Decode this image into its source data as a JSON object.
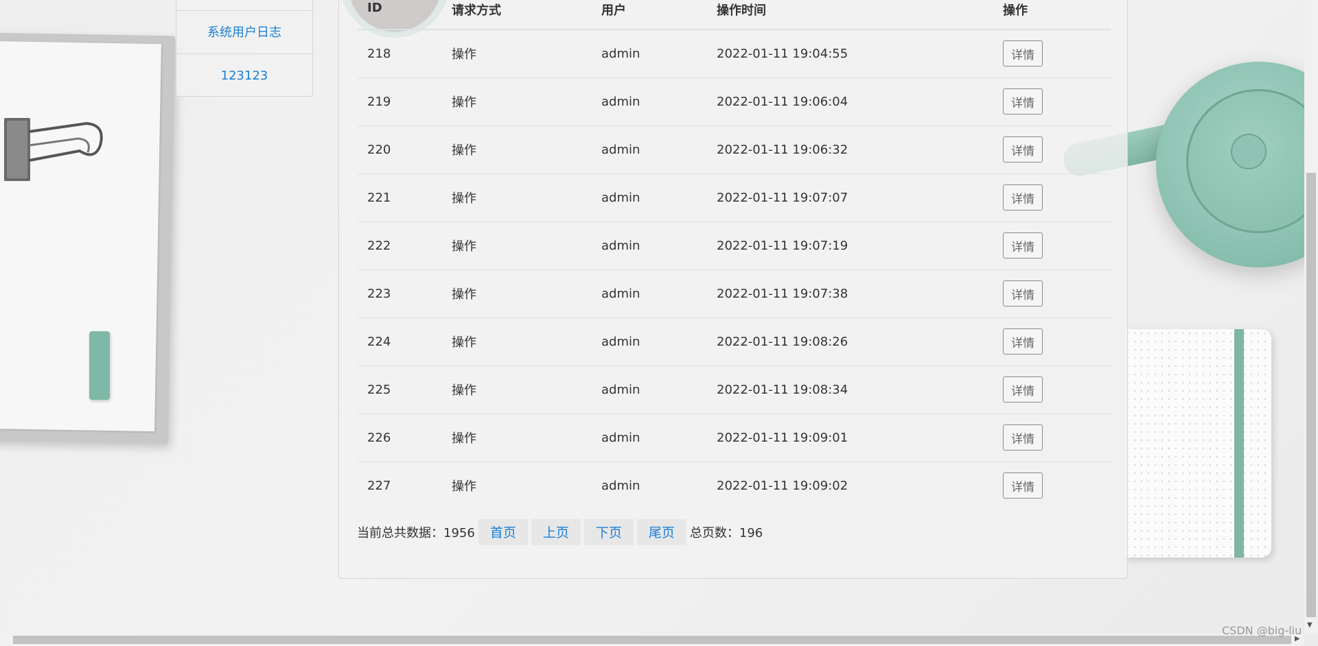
{
  "sidebar": {
    "items": [
      {
        "label": ""
      },
      {
        "label": "系统用户日志"
      },
      {
        "label": "123123"
      }
    ]
  },
  "table": {
    "headers": [
      "ID",
      "请求方式",
      "用户",
      "操作时间",
      "操作"
    ],
    "rows": [
      {
        "id": "218",
        "method": "操作",
        "user": "admin",
        "time": "2022-01-11 19:04:55",
        "action": "详情"
      },
      {
        "id": "219",
        "method": "操作",
        "user": "admin",
        "time": "2022-01-11 19:06:04",
        "action": "详情"
      },
      {
        "id": "220",
        "method": "操作",
        "user": "admin",
        "time": "2022-01-11 19:06:32",
        "action": "详情"
      },
      {
        "id": "221",
        "method": "操作",
        "user": "admin",
        "time": "2022-01-11 19:07:07",
        "action": "详情"
      },
      {
        "id": "222",
        "method": "操作",
        "user": "admin",
        "time": "2022-01-11 19:07:19",
        "action": "详情"
      },
      {
        "id": "223",
        "method": "操作",
        "user": "admin",
        "time": "2022-01-11 19:07:38",
        "action": "详情"
      },
      {
        "id": "224",
        "method": "操作",
        "user": "admin",
        "time": "2022-01-11 19:08:26",
        "action": "详情"
      },
      {
        "id": "225",
        "method": "操作",
        "user": "admin",
        "time": "2022-01-11 19:08:34",
        "action": "详情"
      },
      {
        "id": "226",
        "method": "操作",
        "user": "admin",
        "time": "2022-01-11 19:09:01",
        "action": "详情"
      },
      {
        "id": "227",
        "method": "操作",
        "user": "admin",
        "time": "2022-01-11 19:09:02",
        "action": "详情"
      }
    ]
  },
  "pager": {
    "total_label": "当前总共数据：1956",
    "first": "首页",
    "prev": "上页",
    "next": "下页",
    "last": "尾页",
    "pages_label": "总页数：196"
  },
  "watermark": "CSDN @big-liu",
  "colors": {
    "link": "#1a7fd6",
    "accent_teal": "#8fc4b4"
  }
}
